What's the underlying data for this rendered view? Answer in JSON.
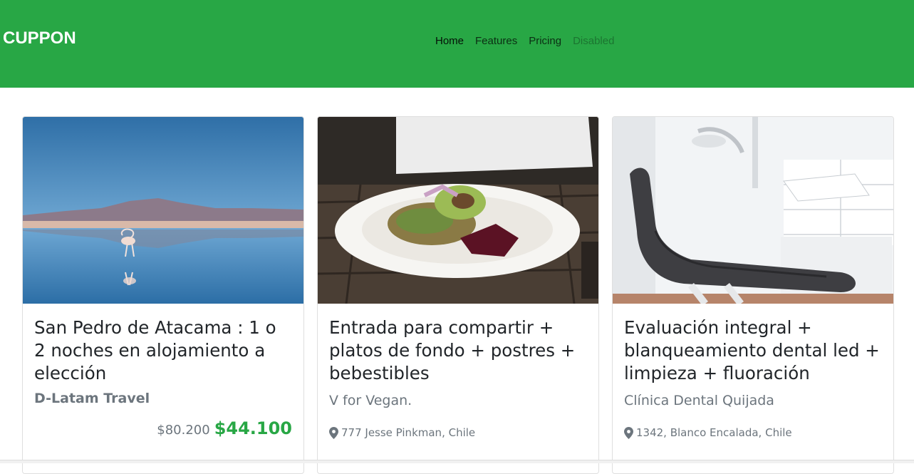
{
  "navbar": {
    "brand": "CUPPON",
    "links": [
      {
        "label": "Home",
        "state": "active"
      },
      {
        "label": "Features",
        "state": "normal"
      },
      {
        "label": "Pricing",
        "state": "normal"
      },
      {
        "label": "Disabled",
        "state": "disabled"
      }
    ]
  },
  "colors": {
    "brand_green": "#28a745",
    "muted_text": "#6c757d"
  },
  "cards": [
    {
      "image": "salt-lake-flamingo-photo",
      "title": "San Pedro de Atacama : 1 o 2 noches en alojamiento a elección",
      "company": "D-Latam Travel",
      "old_price": "$80.200",
      "new_price": "$44.100"
    },
    {
      "image": "vegan-salad-plate-photo",
      "title": "Entrada para compartir + platos de fondo + postres + bebestibles",
      "company": "V for Vegan.",
      "location_icon": "map-marker-icon",
      "location": "777 Jesse Pinkman, Chile"
    },
    {
      "image": "dental-chair-photo",
      "title": "Evaluación integral + blanqueamiento dental led + limpieza + fluoración",
      "company": "Clínica Dental Quijada",
      "location_icon": "map-marker-icon",
      "location": "1342, Blanco Encalada, Chile"
    }
  ]
}
